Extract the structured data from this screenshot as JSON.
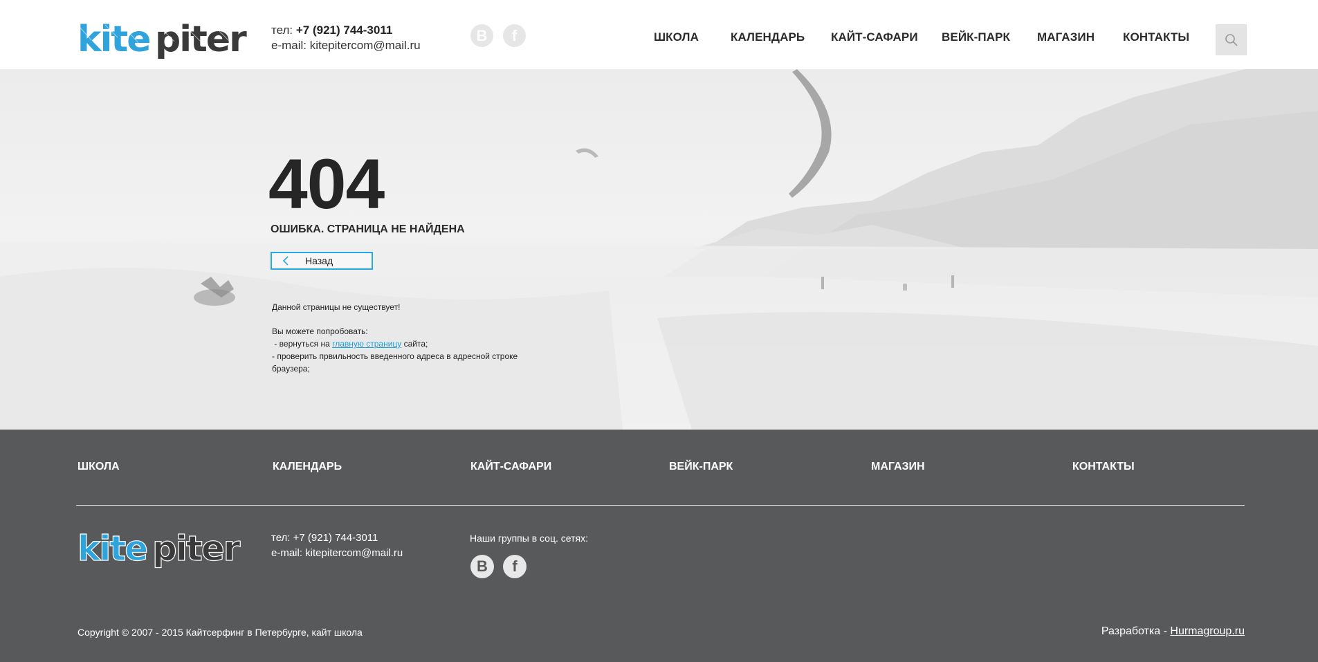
{
  "header": {
    "logo_text": "kitepiter",
    "phone_prefix": "тел:",
    "phone": "+7 (921) 744-3011",
    "email_line": "e-mail: kitepitercom@mail.ru",
    "social": [
      {
        "icon": "vk-icon",
        "glyph": "В"
      },
      {
        "icon": "facebook-icon",
        "glyph": "f"
      }
    ],
    "nav": [
      "ШКОЛА",
      "КАЛЕНДАРЬ",
      "КАЙТ-САФАРИ",
      "ВЕЙК-ПАРК",
      "МАГАЗИН",
      "КОНТАКТЫ"
    ],
    "search_icon": "search-icon"
  },
  "error": {
    "code": "404",
    "title": "ОШИБКА. СТРАНИЦА НЕ НАЙДЕНА",
    "back_label": "Назад",
    "not_exist": "Данной страницы не существует!",
    "try_label": "Вы можете попробовать:",
    "return_prefix": " - вернуться на ",
    "return_link": "главную страницу",
    "return_suffix": " сайта;",
    "check_line1": "- проверить првильность введенного адреса в адресной строке",
    "check_line2": "браузера;"
  },
  "footer": {
    "nav": [
      "ШКОЛА",
      "КАЛЕНДАРЬ",
      "КАЙТ-САФАРИ",
      "ВЕЙК-ПАРК",
      "МАГАЗИН",
      "КОНТАКТЫ"
    ],
    "logo_text": "kitepiter",
    "phone_line": "тел: +7 (921) 744-3011",
    "email_line": "e-mail: kitepitercom@mail.ru",
    "social_label": "Наши группы в соц. сетях:",
    "social": [
      {
        "icon": "vk-icon",
        "glyph": "В"
      },
      {
        "icon": "facebook-icon",
        "glyph": "f"
      }
    ],
    "copyright": "Copyright © 2007 - 2015 Кайтсерфинг в Петербурге, кайт школа",
    "dev_prefix": "Разработка - ",
    "dev_link": "Hurmagroup.ru"
  },
  "colors": {
    "accent": "#29a8e0",
    "logo_blue": "#2ea3dc",
    "logo_dark": "#3a3a3a",
    "footer_bg": "#58595b",
    "link": "#1a9fd9"
  }
}
